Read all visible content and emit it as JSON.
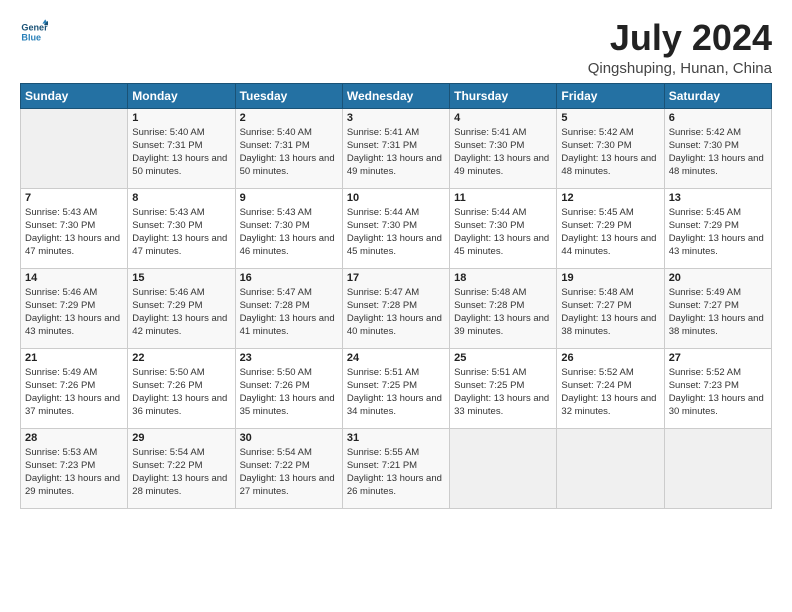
{
  "logo": {
    "line1": "General",
    "line2": "Blue"
  },
  "title": "July 2024",
  "location": "Qingshuping, Hunan, China",
  "days_of_week": [
    "Sunday",
    "Monday",
    "Tuesday",
    "Wednesday",
    "Thursday",
    "Friday",
    "Saturday"
  ],
  "weeks": [
    [
      {
        "day": "",
        "sunrise": "",
        "sunset": "",
        "daylight": ""
      },
      {
        "day": "1",
        "sunrise": "Sunrise: 5:40 AM",
        "sunset": "Sunset: 7:31 PM",
        "daylight": "Daylight: 13 hours and 50 minutes."
      },
      {
        "day": "2",
        "sunrise": "Sunrise: 5:40 AM",
        "sunset": "Sunset: 7:31 PM",
        "daylight": "Daylight: 13 hours and 50 minutes."
      },
      {
        "day": "3",
        "sunrise": "Sunrise: 5:41 AM",
        "sunset": "Sunset: 7:31 PM",
        "daylight": "Daylight: 13 hours and 49 minutes."
      },
      {
        "day": "4",
        "sunrise": "Sunrise: 5:41 AM",
        "sunset": "Sunset: 7:30 PM",
        "daylight": "Daylight: 13 hours and 49 minutes."
      },
      {
        "day": "5",
        "sunrise": "Sunrise: 5:42 AM",
        "sunset": "Sunset: 7:30 PM",
        "daylight": "Daylight: 13 hours and 48 minutes."
      },
      {
        "day": "6",
        "sunrise": "Sunrise: 5:42 AM",
        "sunset": "Sunset: 7:30 PM",
        "daylight": "Daylight: 13 hours and 48 minutes."
      }
    ],
    [
      {
        "day": "7",
        "sunrise": "Sunrise: 5:43 AM",
        "sunset": "Sunset: 7:30 PM",
        "daylight": "Daylight: 13 hours and 47 minutes."
      },
      {
        "day": "8",
        "sunrise": "Sunrise: 5:43 AM",
        "sunset": "Sunset: 7:30 PM",
        "daylight": "Daylight: 13 hours and 47 minutes."
      },
      {
        "day": "9",
        "sunrise": "Sunrise: 5:43 AM",
        "sunset": "Sunset: 7:30 PM",
        "daylight": "Daylight: 13 hours and 46 minutes."
      },
      {
        "day": "10",
        "sunrise": "Sunrise: 5:44 AM",
        "sunset": "Sunset: 7:30 PM",
        "daylight": "Daylight: 13 hours and 45 minutes."
      },
      {
        "day": "11",
        "sunrise": "Sunrise: 5:44 AM",
        "sunset": "Sunset: 7:30 PM",
        "daylight": "Daylight: 13 hours and 45 minutes."
      },
      {
        "day": "12",
        "sunrise": "Sunrise: 5:45 AM",
        "sunset": "Sunset: 7:29 PM",
        "daylight": "Daylight: 13 hours and 44 minutes."
      },
      {
        "day": "13",
        "sunrise": "Sunrise: 5:45 AM",
        "sunset": "Sunset: 7:29 PM",
        "daylight": "Daylight: 13 hours and 43 minutes."
      }
    ],
    [
      {
        "day": "14",
        "sunrise": "Sunrise: 5:46 AM",
        "sunset": "Sunset: 7:29 PM",
        "daylight": "Daylight: 13 hours and 43 minutes."
      },
      {
        "day": "15",
        "sunrise": "Sunrise: 5:46 AM",
        "sunset": "Sunset: 7:29 PM",
        "daylight": "Daylight: 13 hours and 42 minutes."
      },
      {
        "day": "16",
        "sunrise": "Sunrise: 5:47 AM",
        "sunset": "Sunset: 7:28 PM",
        "daylight": "Daylight: 13 hours and 41 minutes."
      },
      {
        "day": "17",
        "sunrise": "Sunrise: 5:47 AM",
        "sunset": "Sunset: 7:28 PM",
        "daylight": "Daylight: 13 hours and 40 minutes."
      },
      {
        "day": "18",
        "sunrise": "Sunrise: 5:48 AM",
        "sunset": "Sunset: 7:28 PM",
        "daylight": "Daylight: 13 hours and 39 minutes."
      },
      {
        "day": "19",
        "sunrise": "Sunrise: 5:48 AM",
        "sunset": "Sunset: 7:27 PM",
        "daylight": "Daylight: 13 hours and 38 minutes."
      },
      {
        "day": "20",
        "sunrise": "Sunrise: 5:49 AM",
        "sunset": "Sunset: 7:27 PM",
        "daylight": "Daylight: 13 hours and 38 minutes."
      }
    ],
    [
      {
        "day": "21",
        "sunrise": "Sunrise: 5:49 AM",
        "sunset": "Sunset: 7:26 PM",
        "daylight": "Daylight: 13 hours and 37 minutes."
      },
      {
        "day": "22",
        "sunrise": "Sunrise: 5:50 AM",
        "sunset": "Sunset: 7:26 PM",
        "daylight": "Daylight: 13 hours and 36 minutes."
      },
      {
        "day": "23",
        "sunrise": "Sunrise: 5:50 AM",
        "sunset": "Sunset: 7:26 PM",
        "daylight": "Daylight: 13 hours and 35 minutes."
      },
      {
        "day": "24",
        "sunrise": "Sunrise: 5:51 AM",
        "sunset": "Sunset: 7:25 PM",
        "daylight": "Daylight: 13 hours and 34 minutes."
      },
      {
        "day": "25",
        "sunrise": "Sunrise: 5:51 AM",
        "sunset": "Sunset: 7:25 PM",
        "daylight": "Daylight: 13 hours and 33 minutes."
      },
      {
        "day": "26",
        "sunrise": "Sunrise: 5:52 AM",
        "sunset": "Sunset: 7:24 PM",
        "daylight": "Daylight: 13 hours and 32 minutes."
      },
      {
        "day": "27",
        "sunrise": "Sunrise: 5:52 AM",
        "sunset": "Sunset: 7:23 PM",
        "daylight": "Daylight: 13 hours and 30 minutes."
      }
    ],
    [
      {
        "day": "28",
        "sunrise": "Sunrise: 5:53 AM",
        "sunset": "Sunset: 7:23 PM",
        "daylight": "Daylight: 13 hours and 29 minutes."
      },
      {
        "day": "29",
        "sunrise": "Sunrise: 5:54 AM",
        "sunset": "Sunset: 7:22 PM",
        "daylight": "Daylight: 13 hours and 28 minutes."
      },
      {
        "day": "30",
        "sunrise": "Sunrise: 5:54 AM",
        "sunset": "Sunset: 7:22 PM",
        "daylight": "Daylight: 13 hours and 27 minutes."
      },
      {
        "day": "31",
        "sunrise": "Sunrise: 5:55 AM",
        "sunset": "Sunset: 7:21 PM",
        "daylight": "Daylight: 13 hours and 26 minutes."
      },
      {
        "day": "",
        "sunrise": "",
        "sunset": "",
        "daylight": ""
      },
      {
        "day": "",
        "sunrise": "",
        "sunset": "",
        "daylight": ""
      },
      {
        "day": "",
        "sunrise": "",
        "sunset": "",
        "daylight": ""
      }
    ]
  ]
}
